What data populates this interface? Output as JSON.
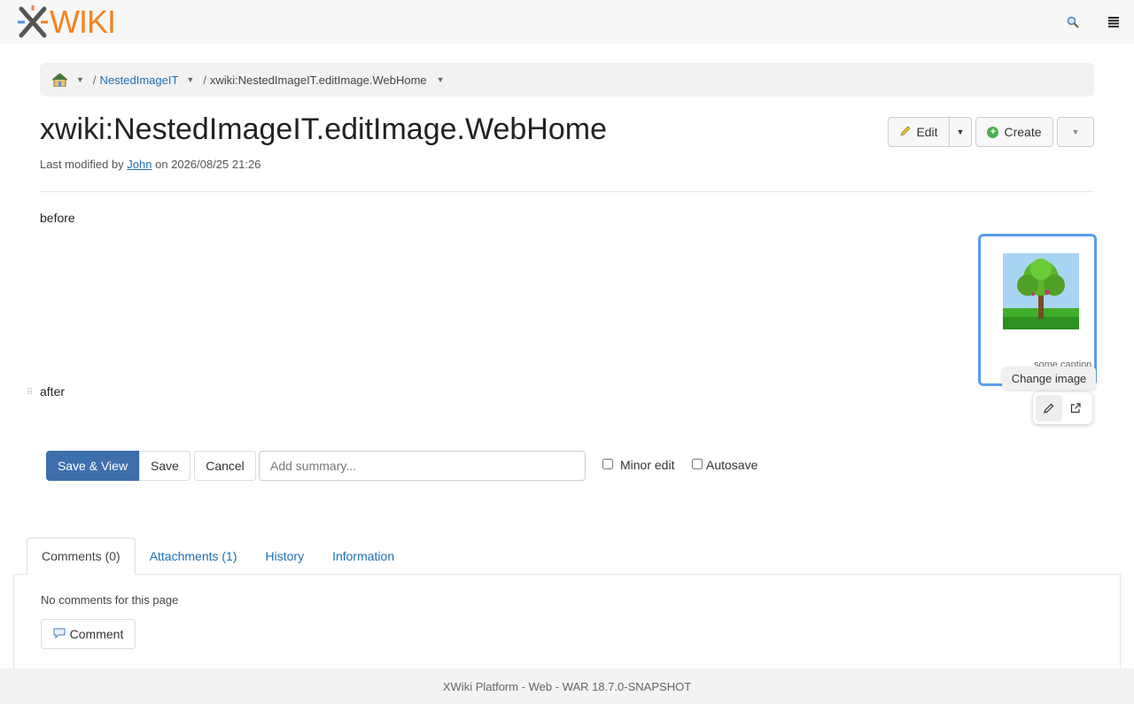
{
  "header": {
    "logo_text": "WIKI",
    "search_icon": "search-icon",
    "menu_icon": "menu-icon"
  },
  "breadcrumb": {
    "home_icon": "home-icon",
    "items": [
      {
        "label": "NestedImageIT"
      },
      {
        "label": "xwiki:NestedImageIT.editImage.WebHome"
      }
    ]
  },
  "page": {
    "title": "xwiki:NestedImageIT.editImage.WebHome",
    "modified_prefix": "Last modified by",
    "modified_user": "John",
    "modified_suffix": "on 2026/08/25 21:26"
  },
  "actions": {
    "edit_label": "Edit",
    "create_label": "Create"
  },
  "content": {
    "before": "before",
    "after": "after",
    "caption": "some caption"
  },
  "image_toolbar": {
    "tooltip": "Change image"
  },
  "editor": {
    "save_view_label": "Save & View",
    "save_label": "Save",
    "cancel_label": "Cancel",
    "summary_placeholder": "Add summary...",
    "minor_edit_label": "Minor edit",
    "autosave_label": "Autosave"
  },
  "tabs": [
    {
      "label": "Comments (0)",
      "active": true
    },
    {
      "label": "Attachments (1)"
    },
    {
      "label": "History"
    },
    {
      "label": "Information"
    }
  ],
  "comments": {
    "empty_text": "No comments for this page",
    "button_label": "Comment"
  },
  "footer": {
    "text": "XWiki Platform - Web - WAR 18.7.0-SNAPSHOT"
  },
  "colors": {
    "accent": "#3e6fad",
    "link": "#1f6fb2",
    "logo_orange": "#f58220",
    "selection": "#5b9cf0"
  }
}
